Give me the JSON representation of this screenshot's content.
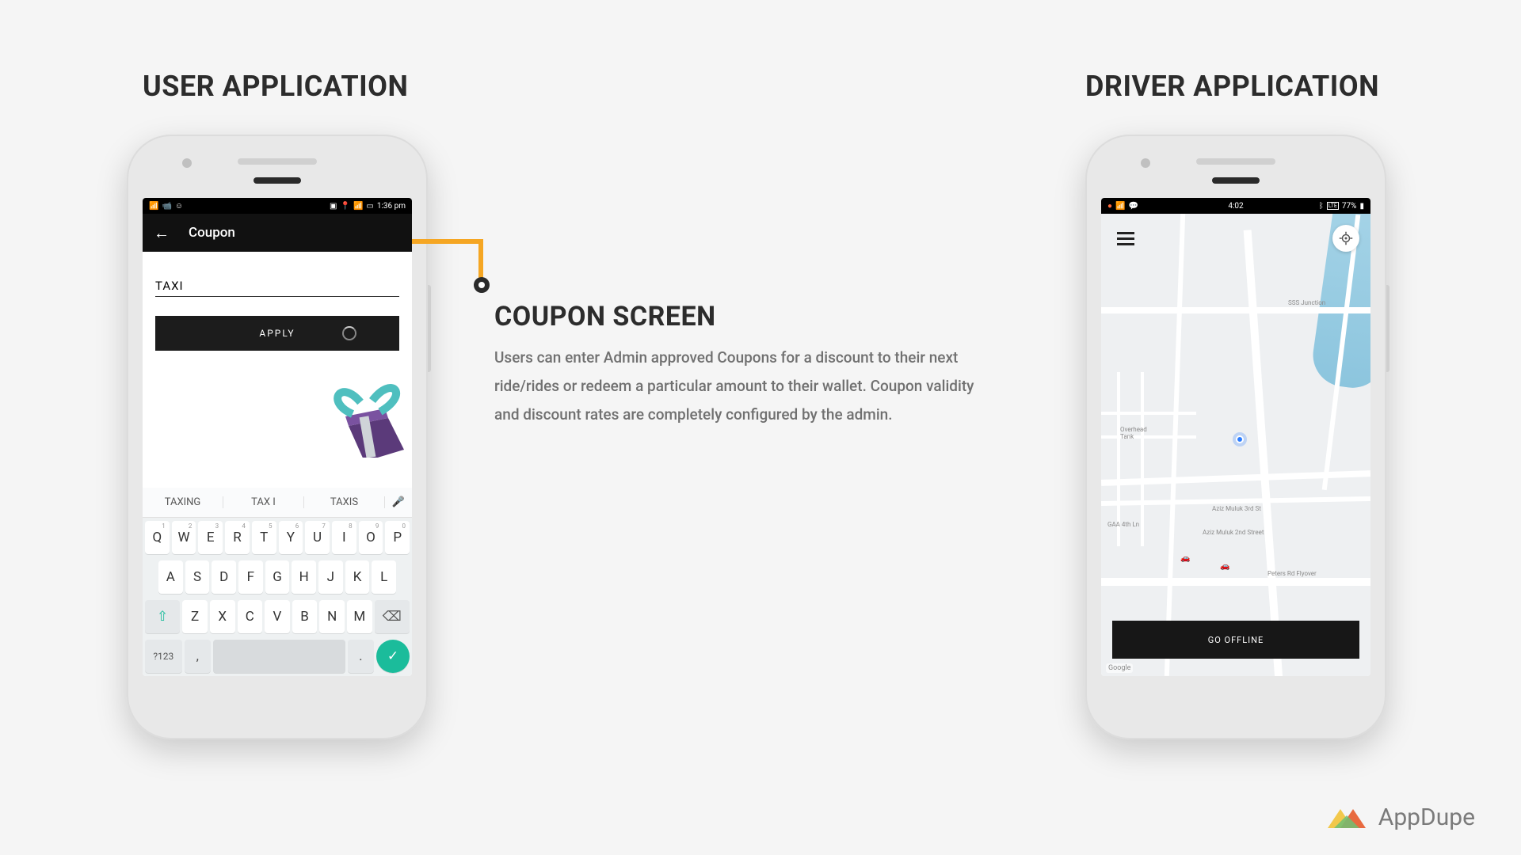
{
  "left_heading": "USER APPLICATION",
  "right_heading": "DRIVER APPLICATION",
  "callout": {
    "title": "COUPON SCREEN",
    "body": "Users can enter Admin approved Coupons for a discount to their next ride/rides or redeem a particular amount to their wallet. Coupon validity and discount rates are completely configured by the admin."
  },
  "user_app": {
    "status_time": "1:36 pm",
    "header_title": "Coupon",
    "coupon_value": "TAXI",
    "apply_label": "APPLY",
    "keyboard": {
      "suggestions": [
        "TAXING",
        "TAX I",
        "TAXIS"
      ],
      "row1": [
        "Q",
        "W",
        "E",
        "R",
        "T",
        "Y",
        "U",
        "I",
        "O",
        "P"
      ],
      "row1_nums": [
        "1",
        "2",
        "3",
        "4",
        "5",
        "6",
        "7",
        "8",
        "9",
        "0"
      ],
      "row2": [
        "A",
        "S",
        "D",
        "F",
        "G",
        "H",
        "J",
        "K",
        "L"
      ],
      "row3": [
        "Z",
        "X",
        "C",
        "V",
        "B",
        "N",
        "M"
      ],
      "symbols_key": "?123",
      "comma_key": ",",
      "period_key": "."
    }
  },
  "driver_app": {
    "status_time": "4:02",
    "battery_text": "77%",
    "offline_label": "GO OFFLINE",
    "google_label": "Google",
    "map_labels": {
      "sss": "SSS Junction",
      "overhead": "Overhead\nTank",
      "peters": "Peters Rd Flyover",
      "aziz1": "Aziz Muluk 3rd St",
      "aziz2": "Aziz Muluk 2nd Street",
      "gaa": "GAA 4th Ln"
    }
  },
  "brand": "AppDupe"
}
